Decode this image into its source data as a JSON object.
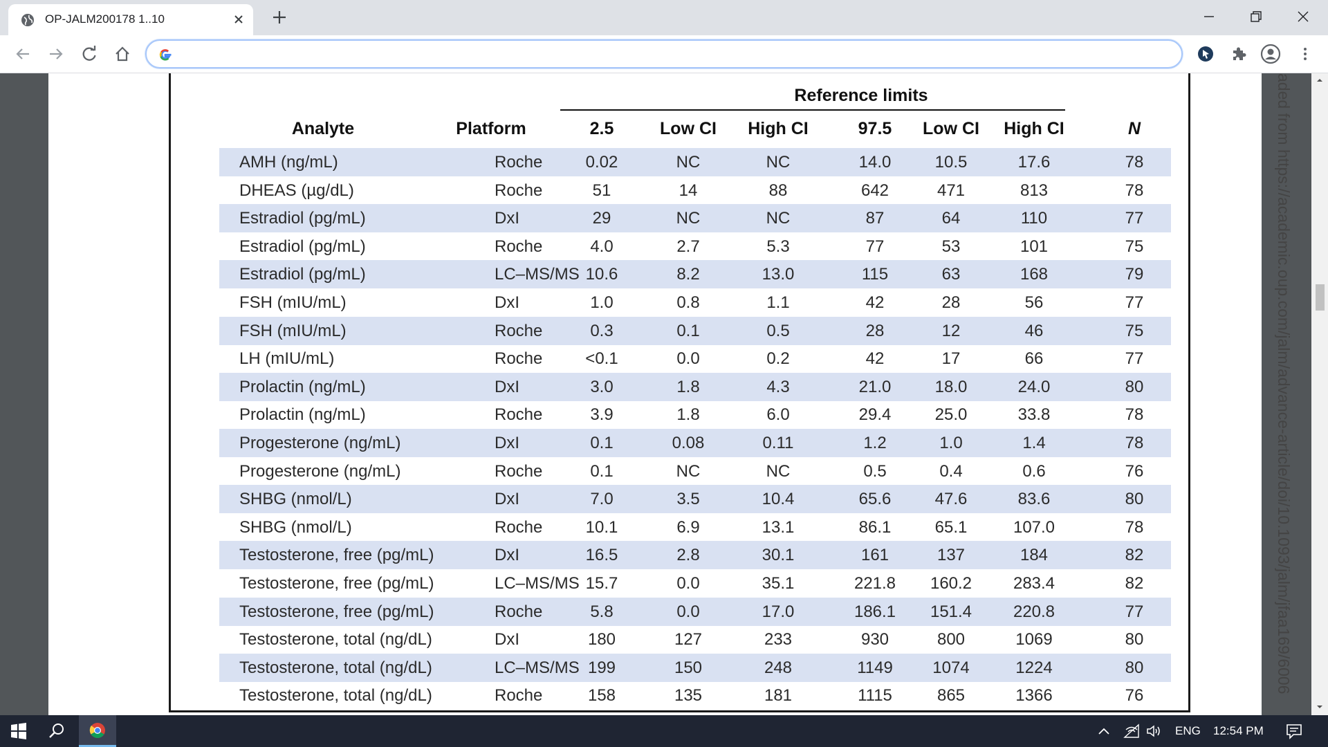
{
  "browser": {
    "tab_title": "OP-JALM200178 1..10",
    "address_value": "",
    "address_placeholder": ""
  },
  "table": {
    "group_header": "Reference limits",
    "columns": [
      "Analyte",
      "Platform",
      "2.5",
      "Low CI",
      "High CI",
      "97.5",
      "Low CI",
      "High CI",
      "N"
    ],
    "rows": [
      [
        "AMH (ng/mL)",
        "Roche",
        "0.02",
        "NC",
        "NC",
        "14.0",
        "10.5",
        "17.6",
        "78"
      ],
      [
        "DHEAS (µg/dL)",
        "Roche",
        "51",
        "14",
        "88",
        "642",
        "471",
        "813",
        "78"
      ],
      [
        "Estradiol (pg/mL)",
        "DxI",
        "29",
        "NC",
        "NC",
        "87",
        "64",
        "110",
        "77"
      ],
      [
        "Estradiol (pg/mL)",
        "Roche",
        "4.0",
        "2.7",
        "5.3",
        "77",
        "53",
        "101",
        "75"
      ],
      [
        "Estradiol (pg/mL)",
        "LC–MS/MS",
        "10.6",
        "8.2",
        "13.0",
        "115",
        "63",
        "168",
        "79"
      ],
      [
        "FSH (mIU/mL)",
        "DxI",
        "1.0",
        "0.8",
        "1.1",
        "42",
        "28",
        "56",
        "77"
      ],
      [
        "FSH (mIU/mL)",
        "Roche",
        "0.3",
        "0.1",
        "0.5",
        "28",
        "12",
        "46",
        "75"
      ],
      [
        "LH (mIU/mL)",
        "Roche",
        "<0.1",
        "0.0",
        "0.2",
        "42",
        "17",
        "66",
        "77"
      ],
      [
        "Prolactin (ng/mL)",
        "DxI",
        "3.0",
        "1.8",
        "4.3",
        "21.0",
        "18.0",
        "24.0",
        "80"
      ],
      [
        "Prolactin (ng/mL)",
        "Roche",
        "3.9",
        "1.8",
        "6.0",
        "29.4",
        "25.0",
        "33.8",
        "78"
      ],
      [
        "Progesterone (ng/mL)",
        "DxI",
        "0.1",
        "0.08",
        "0.11",
        "1.2",
        "1.0",
        "1.4",
        "78"
      ],
      [
        "Progesterone (ng/mL)",
        "Roche",
        "0.1",
        "NC",
        "NC",
        "0.5",
        "0.4",
        "0.6",
        "76"
      ],
      [
        "SHBG (nmol/L)",
        "DxI",
        "7.0",
        "3.5",
        "10.4",
        "65.6",
        "47.6",
        "83.6",
        "80"
      ],
      [
        "SHBG (nmol/L)",
        "Roche",
        "10.1",
        "6.9",
        "13.1",
        "86.1",
        "65.1",
        "107.0",
        "78"
      ],
      [
        "Testosterone, free (pg/mL)",
        "DxI",
        "16.5",
        "2.8",
        "30.1",
        "161",
        "137",
        "184",
        "82"
      ],
      [
        "Testosterone, free (pg/mL)",
        "LC–MS/MS",
        "15.7",
        "0.0",
        "35.1",
        "221.8",
        "160.2",
        "283.4",
        "82"
      ],
      [
        "Testosterone, free (pg/mL)",
        "Roche",
        "5.8",
        "0.0",
        "17.0",
        "186.1",
        "151.4",
        "220.8",
        "77"
      ],
      [
        "Testosterone, total (ng/dL)",
        "DxI",
        "180",
        "127",
        "233",
        "930",
        "800",
        "1069",
        "80"
      ],
      [
        "Testosterone, total (ng/dL)",
        "LC–MS/MS",
        "199",
        "150",
        "248",
        "1149",
        "1074",
        "1224",
        "80"
      ],
      [
        "Testosterone, total (ng/dL)",
        "Roche",
        "158",
        "135",
        "181",
        "1115",
        "865",
        "1366",
        "76"
      ]
    ]
  },
  "side_text": "aded from https://academic.oup.com/jalm/advance-article/doi/10.1093/jalm/jfaa169/6006",
  "taskbar": {
    "language": "ENG",
    "time": "12:54 PM"
  },
  "colors": {
    "row_shade": "#d9e1f2",
    "taskbar": "#1f2533",
    "tabstrip": "#dee1e6"
  }
}
